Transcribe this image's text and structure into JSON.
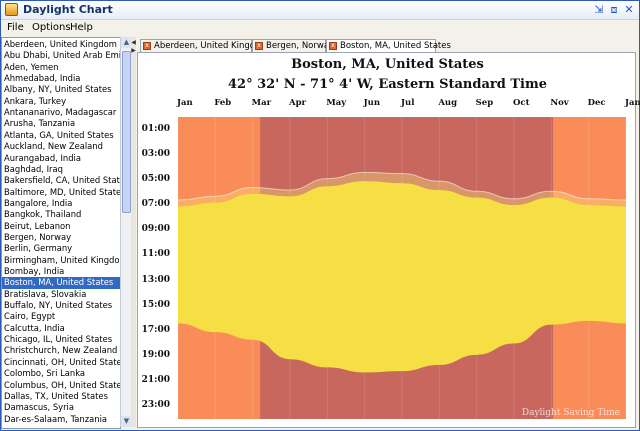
{
  "window": {
    "title": "Daylight Chart",
    "buttons": [
      "minimize-restore-icon",
      "maximize-icon",
      "close-icon"
    ]
  },
  "menu": [
    "File",
    "Options",
    "Help"
  ],
  "cities": [
    "Aberdeen, United Kingdom",
    "Abu Dhabi, United Arab Emirates",
    "Aden, Yemen",
    "Ahmedabad, India",
    "Albany, NY, United States",
    "Ankara, Turkey",
    "Antananarivo, Madagascar",
    "Arusha, Tanzania",
    "Atlanta, GA, United States",
    "Auckland, New Zealand",
    "Aurangabad, India",
    "Baghdad, Iraq",
    "Bakersfield, CA, United States",
    "Baltimore, MD, United States",
    "Bangalore, India",
    "Bangkok, Thailand",
    "Beirut, Lebanon",
    "Bergen, Norway",
    "Berlin, Germany",
    "Birmingham, United Kingdom",
    "Bombay, India",
    "Boston, MA, United States",
    "Bratislava, Slovakia",
    "Buffalo, NY, United States",
    "Cairo, Egypt",
    "Calcutta, India",
    "Chicago, IL, United States",
    "Christchurch, New Zealand",
    "Cincinnati, OH, United States",
    "Colombo, Sri Lanka",
    "Columbus, OH, United States",
    "Dallas, TX, United States",
    "Damascus, Syria",
    "Dar-es-Salaam, Tanzania"
  ],
  "selected_city_index": 21,
  "tabs": [
    {
      "label": "Aberdeen, United Kingdom",
      "active": false
    },
    {
      "label": "Bergen, Norway",
      "active": false
    },
    {
      "label": "Boston, MA, United States",
      "active": true
    }
  ],
  "chart": {
    "title": "Boston, MA, United States",
    "subtitle": "42° 32' N - 71° 4' W, Eastern Standard Time",
    "watermark": "Daylight Saving Time",
    "colors": {
      "night": "#fa8c5a",
      "dst_overlay": "#c8675e",
      "daylight": "#f5df44",
      "twilight": "#f9ed7a"
    }
  },
  "chart_data": {
    "type": "area",
    "months": [
      "Jan",
      "Feb",
      "Mar",
      "Apr",
      "May",
      "Jun",
      "Jul",
      "Aug",
      "Sep",
      "Oct",
      "Nov",
      "Dec",
      "Jan"
    ],
    "hour_ticks": [
      "01:00",
      "03:00",
      "05:00",
      "07:00",
      "09:00",
      "11:00",
      "13:00",
      "15:00",
      "17:00",
      "19:00",
      "21:00",
      "23:00"
    ],
    "y_range_hours": [
      0,
      24
    ],
    "dst_period_months": [
      2.2,
      10.05
    ],
    "sunrise_hours": [
      7.1,
      6.8,
      6.1,
      6.3,
      5.5,
      5.1,
      5.25,
      5.8,
      6.4,
      7.0,
      6.4,
      7.0,
      7.1
    ],
    "sunset_hours": [
      16.4,
      17.1,
      17.7,
      19.25,
      19.9,
      20.3,
      20.2,
      19.7,
      18.9,
      18.0,
      16.5,
      16.2,
      16.4
    ],
    "dawn_hours": [
      6.6,
      6.3,
      5.6,
      5.8,
      4.9,
      4.4,
      4.5,
      5.1,
      5.9,
      6.5,
      5.9,
      6.5,
      6.6
    ]
  }
}
